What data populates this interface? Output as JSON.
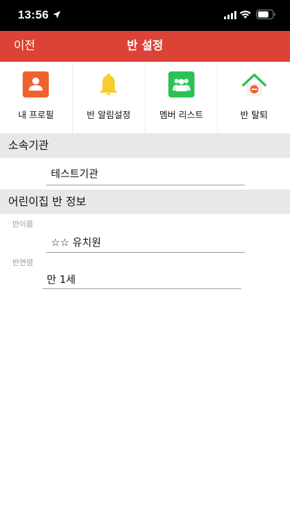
{
  "status_bar": {
    "time": "13:56"
  },
  "nav": {
    "back_label": "이전",
    "title": "반 설정"
  },
  "menu": [
    {
      "label": "내 프로필",
      "icon": "profile-icon",
      "color": "#f0622d"
    },
    {
      "label": "반 알림설정",
      "icon": "bell-icon",
      "color": "#f8cc2a"
    },
    {
      "label": "멤버 리스트",
      "icon": "members-icon",
      "color": "#2cc157"
    },
    {
      "label": "반 탈퇴",
      "icon": "leave-class-icon",
      "color": "#2cc157"
    }
  ],
  "sections": {
    "affiliation": {
      "header": "소속기관",
      "value": "테스트기관"
    },
    "class_info": {
      "header": "어린이집 반 정보",
      "class_name_label": "반이름",
      "class_name_value": "☆☆ 유치원",
      "class_age_label": "반연령",
      "class_age_value": "만 1세"
    }
  },
  "colors": {
    "nav_bg": "#dc4235",
    "section_bg": "#e8e8e8"
  }
}
